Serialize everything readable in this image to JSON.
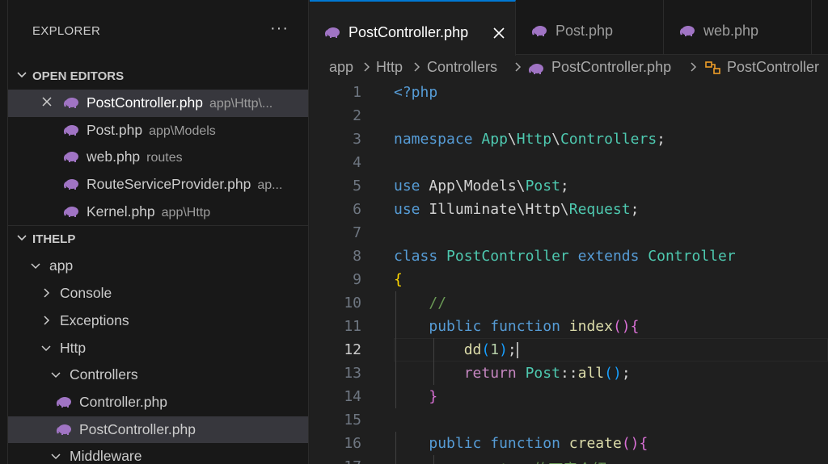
{
  "explorer": {
    "title": "EXPLORER",
    "more_label": "···"
  },
  "open_editors": {
    "header": "OPEN EDITORS",
    "items": [
      {
        "name": "PostController.php",
        "desc": "app\\Http\\..."
      },
      {
        "name": "Post.php",
        "desc": "app\\Models"
      },
      {
        "name": "web.php",
        "desc": "routes"
      },
      {
        "name": "RouteServiceProvider.php",
        "desc": "ap..."
      },
      {
        "name": "Kernel.php",
        "desc": "app\\Http"
      }
    ]
  },
  "project": {
    "header": "ITHELP",
    "tree": [
      {
        "name": "app",
        "type": "folder-open"
      },
      {
        "name": "Console",
        "type": "folder-closed"
      },
      {
        "name": "Exceptions",
        "type": "folder-closed"
      },
      {
        "name": "Http",
        "type": "folder-open"
      },
      {
        "name": "Controllers",
        "type": "folder-open"
      },
      {
        "name": "Controller.php",
        "type": "php-file"
      },
      {
        "name": "PostController.php",
        "type": "php-file"
      },
      {
        "name": "Middleware",
        "type": "folder-open"
      }
    ]
  },
  "tabs": [
    {
      "label": "PostController.php",
      "active": true
    },
    {
      "label": "Post.php",
      "active": false
    },
    {
      "label": "web.php",
      "active": false
    }
  ],
  "breadcrumbs": [
    "app",
    "Http",
    "Controllers",
    "PostController.php",
    "PostController"
  ],
  "code": {
    "current_line": 12,
    "lines": [
      {
        "n": "1",
        "tokens": [
          [
            "kw",
            "<?php"
          ]
        ]
      },
      {
        "n": "2",
        "tokens": []
      },
      {
        "n": "3",
        "tokens": [
          [
            "kw",
            "namespace"
          ],
          [
            "txt",
            " "
          ],
          [
            "cls",
            "App"
          ],
          [
            "txt",
            "\\"
          ],
          [
            "cls",
            "Http"
          ],
          [
            "txt",
            "\\"
          ],
          [
            "cls",
            "Controllers"
          ],
          [
            "txt",
            ";"
          ]
        ]
      },
      {
        "n": "4",
        "tokens": []
      },
      {
        "n": "5",
        "tokens": [
          [
            "kw",
            "use"
          ],
          [
            "txt",
            " App\\Models\\"
          ],
          [
            "cls",
            "Post"
          ],
          [
            "txt",
            ";"
          ]
        ]
      },
      {
        "n": "6",
        "tokens": [
          [
            "kw",
            "use"
          ],
          [
            "txt",
            " Illuminate\\Http\\"
          ],
          [
            "cls",
            "Request"
          ],
          [
            "txt",
            ";"
          ]
        ]
      },
      {
        "n": "7",
        "tokens": []
      },
      {
        "n": "8",
        "tokens": [
          [
            "kw",
            "class"
          ],
          [
            "txt",
            " "
          ],
          [
            "cls",
            "PostController"
          ],
          [
            "txt",
            " "
          ],
          [
            "kw",
            "extends"
          ],
          [
            "txt",
            " "
          ],
          [
            "cls",
            "Controller"
          ]
        ]
      },
      {
        "n": "9",
        "tokens": [
          [
            "br1",
            "{"
          ]
        ]
      },
      {
        "n": "10",
        "tokens": [
          [
            "txt",
            "    "
          ],
          [
            "cmt",
            "//"
          ]
        ]
      },
      {
        "n": "11",
        "tokens": [
          [
            "txt",
            "    "
          ],
          [
            "kw",
            "public"
          ],
          [
            "txt",
            " "
          ],
          [
            "kw",
            "function"
          ],
          [
            "txt",
            " "
          ],
          [
            "fn",
            "index"
          ],
          [
            "br2",
            "()"
          ],
          [
            "br2",
            "{"
          ]
        ]
      },
      {
        "n": "12",
        "tokens": [
          [
            "txt",
            "        "
          ],
          [
            "fn",
            "dd"
          ],
          [
            "br3",
            "("
          ],
          [
            "num",
            "1"
          ],
          [
            "br3",
            ")"
          ],
          [
            "txt",
            ";"
          ]
        ]
      },
      {
        "n": "13",
        "tokens": [
          [
            "txt",
            "        "
          ],
          [
            "kw2",
            "return"
          ],
          [
            "txt",
            " "
          ],
          [
            "cls",
            "Post"
          ],
          [
            "txt",
            "::"
          ],
          [
            "fn",
            "all"
          ],
          [
            "br3",
            "()"
          ],
          [
            "txt",
            ";"
          ]
        ]
      },
      {
        "n": "14",
        "tokens": [
          [
            "txt",
            "    "
          ],
          [
            "br2",
            "}"
          ]
        ]
      },
      {
        "n": "15",
        "tokens": []
      },
      {
        "n": "16",
        "tokens": [
          [
            "txt",
            "    "
          ],
          [
            "kw",
            "public"
          ],
          [
            "txt",
            " "
          ],
          [
            "kw",
            "function"
          ],
          [
            "txt",
            " "
          ],
          [
            "fn",
            "create"
          ],
          [
            "br2",
            "()"
          ],
          [
            "br2",
            "{"
          ]
        ]
      },
      {
        "n": "17",
        "tokens": [
          [
            "txt",
            "        "
          ],
          [
            "cmt",
            "// View 的下章介紹"
          ]
        ]
      }
    ]
  },
  "colors": {
    "accent": "#0078d4",
    "php_icon": "#a074c4"
  },
  "icons": [
    "close-icon",
    "php-elephant-icon",
    "chevron-down-icon",
    "chevron-right-icon",
    "class-symbol-icon"
  ]
}
